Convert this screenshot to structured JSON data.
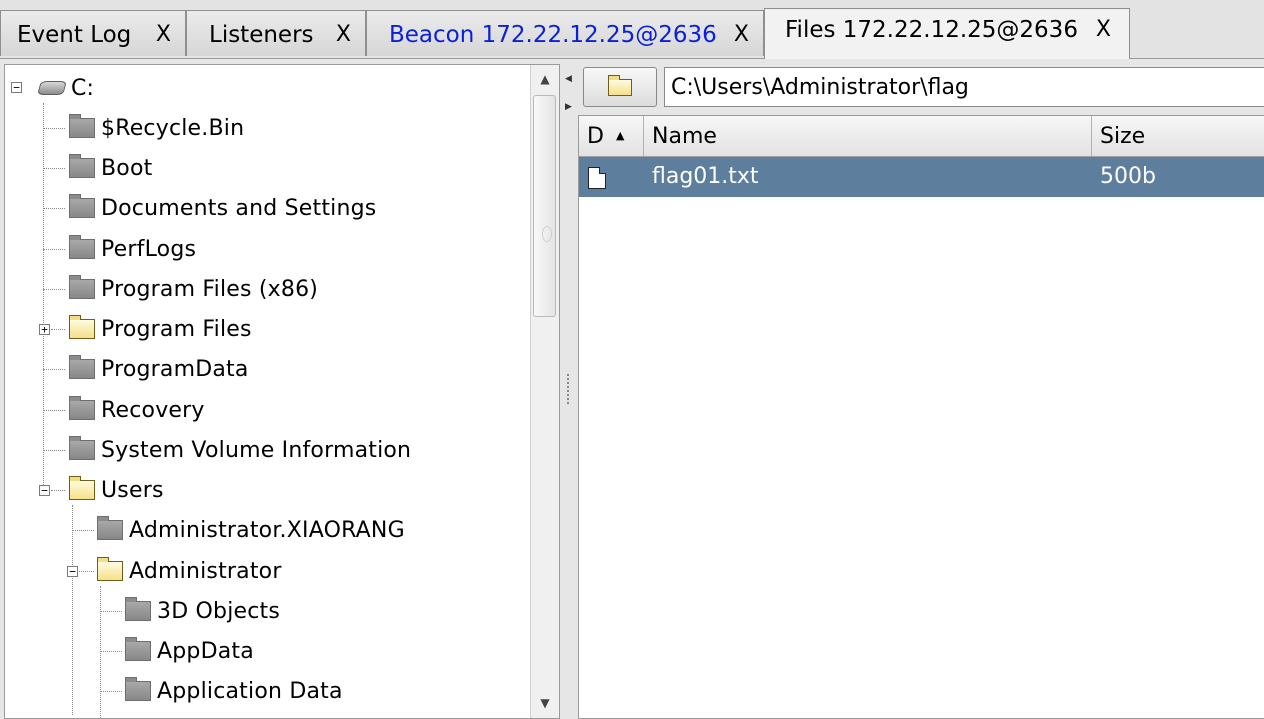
{
  "tabs": [
    {
      "label": "Event Log",
      "close": "X"
    },
    {
      "label": "Listeners",
      "close": "X"
    },
    {
      "label": "Beacon 172.22.12.25@2636",
      "close": "X"
    },
    {
      "label": "Files 172.22.12.25@2636",
      "close": "X"
    }
  ],
  "tree": {
    "root": "C:",
    "items": [
      {
        "label": "$Recycle.Bin"
      },
      {
        "label": "Boot"
      },
      {
        "label": "Documents and Settings"
      },
      {
        "label": "PerfLogs"
      },
      {
        "label": "Program Files (x86)"
      },
      {
        "label": "Program Files"
      },
      {
        "label": "ProgramData"
      },
      {
        "label": "Recovery"
      },
      {
        "label": "System Volume Information"
      },
      {
        "label": "Users"
      },
      {
        "label": "Administrator.XIAORANG"
      },
      {
        "label": "Administrator"
      },
      {
        "label": "3D Objects"
      },
      {
        "label": "AppData"
      },
      {
        "label": "Application Data"
      }
    ],
    "expander_collapsed": "+",
    "expander_expanded": "−"
  },
  "path": {
    "value": "C:\\Users\\Administrator\\flag"
  },
  "file_table": {
    "columns": [
      "D",
      "Name",
      "Size"
    ],
    "rows": [
      {
        "name": "flag01.txt",
        "size": "500b"
      }
    ]
  },
  "icons": {
    "drive": "drive-icon",
    "folder": "folder-icon",
    "open_folder": "open-folder-icon",
    "file": "file-icon"
  }
}
